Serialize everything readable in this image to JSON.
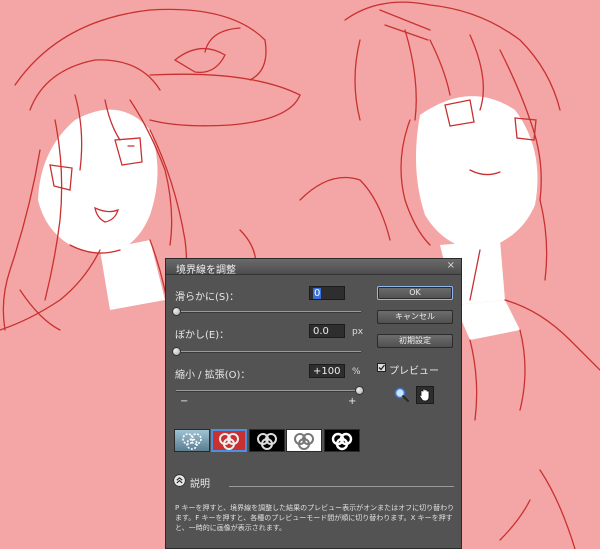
{
  "dialog": {
    "title": "境界線を調整",
    "close_glyph": "×",
    "smooth": {
      "label": "滑らかに(S)：",
      "value": "0",
      "position": 0
    },
    "feather": {
      "label": "ぼかし(E)：",
      "value": "0.0",
      "unit": "px",
      "position": 0
    },
    "contract": {
      "label": "縮小 / 拡張(O)：",
      "value": "+100",
      "unit": "%",
      "position": 1.0,
      "minus": "−",
      "plus": "+"
    },
    "buttons": {
      "ok": "OK",
      "cancel": "キャンセル",
      "reset": "初期設定"
    },
    "preview": {
      "label": "プレビュー",
      "checked": true
    },
    "tools": [
      "zoom-tool",
      "hand-tool"
    ],
    "view_modes": [
      {
        "name": "view-mode-marching-ants",
        "active": false
      },
      {
        "name": "view-mode-overlay",
        "active": true
      },
      {
        "name": "view-mode-on-black",
        "active": false
      },
      {
        "name": "view-mode-on-white",
        "active": false
      },
      {
        "name": "view-mode-mask",
        "active": false
      }
    ],
    "description": {
      "label": "説明",
      "text": "P キーを押すと、境界線を調整した結果のプレビュー表示がオンまたはオフに切り替わります。F キーを押すと、各種のプレビューモード間が順に切り替わります。X キーを押すと、一時的に画像が表示されます。"
    }
  },
  "colors": {
    "overlay": "#f4a6a6",
    "line_art": "#c8312f",
    "dialog_bg": "#535353",
    "accent": "#4a8fe0"
  }
}
